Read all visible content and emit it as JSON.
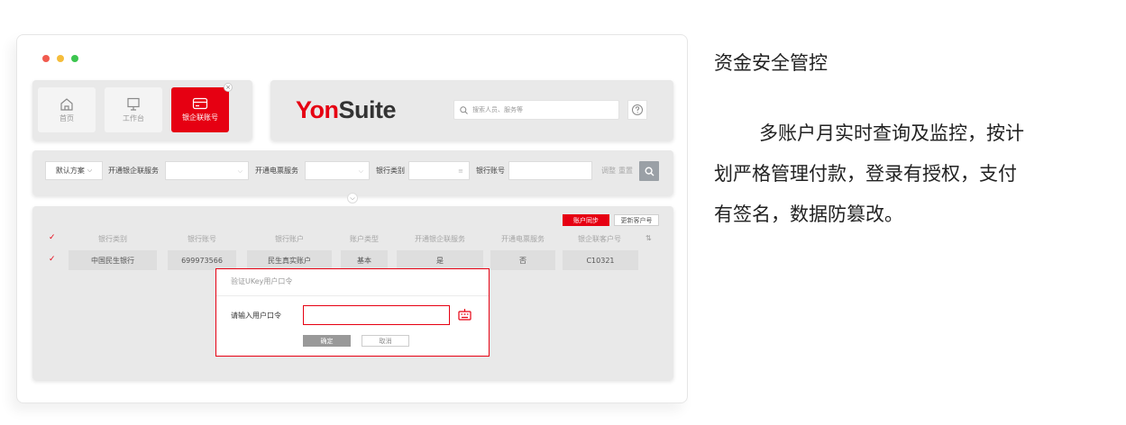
{
  "colors": {
    "accent": "#e60012",
    "panel": "#e9e9e9",
    "dot_red": "#f15b4f",
    "dot_yellow": "#f5bd3b",
    "dot_green": "#3cc54f"
  },
  "nav": {
    "tiles": [
      {
        "label": "首页",
        "icon": "home-icon"
      },
      {
        "label": "工作台",
        "icon": "monitor-icon"
      },
      {
        "label": "银企联账号",
        "icon": "card-icon",
        "active": true
      }
    ]
  },
  "header": {
    "logo_part1": "Yon",
    "logo_part2": "Suite",
    "search_placeholder": "搜索人员、服务等",
    "help_icon": "help-icon"
  },
  "filter": {
    "scheme": "默认方案",
    "label_bank_service": "开通银企联服务",
    "label_bill_service": "开通电票服务",
    "label_bank_type": "银行类别",
    "label_account_no": "银行账号",
    "adjust": "调整",
    "reset": "重置"
  },
  "table": {
    "btn_sync": "账户同步",
    "btn_update": "更新客户号",
    "headers": [
      "银行类别",
      "银行账号",
      "银行账户",
      "账户类型",
      "开通银企联服务",
      "开通电票服务",
      "银企联客户号"
    ],
    "row": [
      "中国民生银行",
      "699973566",
      "民生真实账户",
      "基本",
      "是",
      "否",
      "C10321"
    ]
  },
  "dialog": {
    "title": "验证UKey用户口令",
    "field_label": "请输入用户口令",
    "ok": "确定",
    "cancel": "取消"
  },
  "right": {
    "title": "资金安全管控",
    "desc_line1": "多账户月实时查询及监控，按计",
    "desc_line2": "划严格管理付款，登录有授权，支付",
    "desc_line3": "有签名，数据防篡改。"
  }
}
